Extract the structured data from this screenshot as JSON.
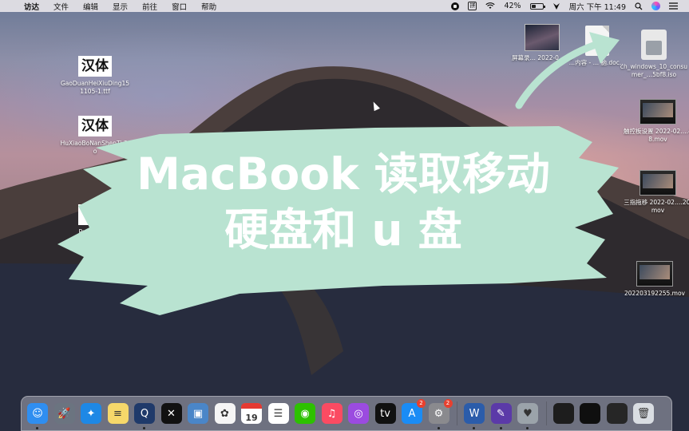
{
  "menubar": {
    "apple_glyph": "",
    "items": [
      "访达",
      "文件",
      "编辑",
      "显示",
      "前往",
      "窗口",
      "帮助"
    ],
    "ime": "拼",
    "battery_percent": 42,
    "battery_label": "42%",
    "clock": "周六 下午 11:49"
  },
  "banner": {
    "line1": "MacBook 读取移动",
    "line2": "硬盘和 u 盘"
  },
  "desktop_left": [
    {
      "icon": "font-file-icon",
      "glyph": "汉体",
      "label": "GaoDuanHeiXiuDing151105-1.ttf"
    },
    {
      "icon": "font-file-icon",
      "glyph": "汉体",
      "label": "HuXiaoBoNanShenTi-2.o"
    },
    {
      "icon": "font-file-icon",
      "glyph": "汉",
      "label": "PangM... ol"
    }
  ],
  "desktop_right": [
    {
      "icon": "screenshot-file-icon",
      "label": "屏幕录… 2022-0…08"
    },
    {
      "icon": "document-file-icon",
      "label": "…内容 - … 脑.doc…"
    },
    {
      "icon": "iso-file-icon",
      "label": "cn_windows_10_consumer_…5bf8.iso"
    },
    {
      "icon": "video-file-icon",
      "label": "触控板设置 2022-02….48.mov"
    },
    {
      "icon": "video-file-icon",
      "label": "三指拖移 2022-02….20.mov"
    },
    {
      "icon": "video-file-icon",
      "label": "202203192255.mov"
    }
  ],
  "dock": {
    "apps": [
      {
        "name": "finder",
        "glyph": "☺",
        "bg": "#2f8ef0",
        "running": true
      },
      {
        "name": "launchpad",
        "glyph": "🚀",
        "bg": "#6b7480",
        "running": false
      },
      {
        "name": "safari",
        "glyph": "✦",
        "bg": "#1e88e5",
        "running": false
      },
      {
        "name": "notes",
        "glyph": "≡",
        "bg": "#f6d86a",
        "running": false
      },
      {
        "name": "quicktime",
        "glyph": "Q",
        "bg": "#1f3a6a",
        "running": true
      },
      {
        "name": "capcut",
        "glyph": "✕",
        "bg": "#111111",
        "running": false
      },
      {
        "name": "preview",
        "glyph": "▣",
        "bg": "#4a86c8",
        "running": false
      },
      {
        "name": "photos",
        "glyph": "✿",
        "bg": "#f5f5f5",
        "running": false
      },
      {
        "name": "calendar",
        "glyph": "19",
        "bg": "#ffffff",
        "running": false
      },
      {
        "name": "reminders",
        "glyph": "☰",
        "bg": "#ffffff",
        "running": false
      },
      {
        "name": "wechat",
        "glyph": "◉",
        "bg": "#2dc100",
        "running": false
      },
      {
        "name": "music",
        "glyph": "♫",
        "bg": "#fb4b62",
        "running": false
      },
      {
        "name": "podcasts",
        "glyph": "◎",
        "bg": "#9b4be0",
        "running": false
      },
      {
        "name": "apple-tv",
        "glyph": "tv",
        "bg": "#111111",
        "running": false
      },
      {
        "name": "app-store",
        "glyph": "A",
        "bg": "#1a8cf5",
        "running": false,
        "badge": "2"
      },
      {
        "name": "system-preferences",
        "glyph": "⚙",
        "bg": "#8a8a8e",
        "running": true,
        "badge": "2"
      }
    ],
    "recent": [
      {
        "name": "word",
        "glyph": "W",
        "bg": "#2b5caa",
        "running": true
      },
      {
        "name": "screenshot-tool",
        "glyph": "✎",
        "bg": "#5b3aa8",
        "running": true
      },
      {
        "name": "activity-monitor",
        "glyph": "♥",
        "bg": "#9ba3aa",
        "running": true
      }
    ],
    "stacks": [
      {
        "name": "recent-video-1",
        "glyph": "",
        "bg": "#1d1d1d"
      },
      {
        "name": "recent-video-2",
        "glyph": "",
        "bg": "#0f0f0f"
      },
      {
        "name": "recent-video-3",
        "glyph": "",
        "bg": "#262626"
      }
    ],
    "trash": {
      "name": "trash",
      "glyph": "🗑",
      "bg": "#d9dde2"
    }
  }
}
